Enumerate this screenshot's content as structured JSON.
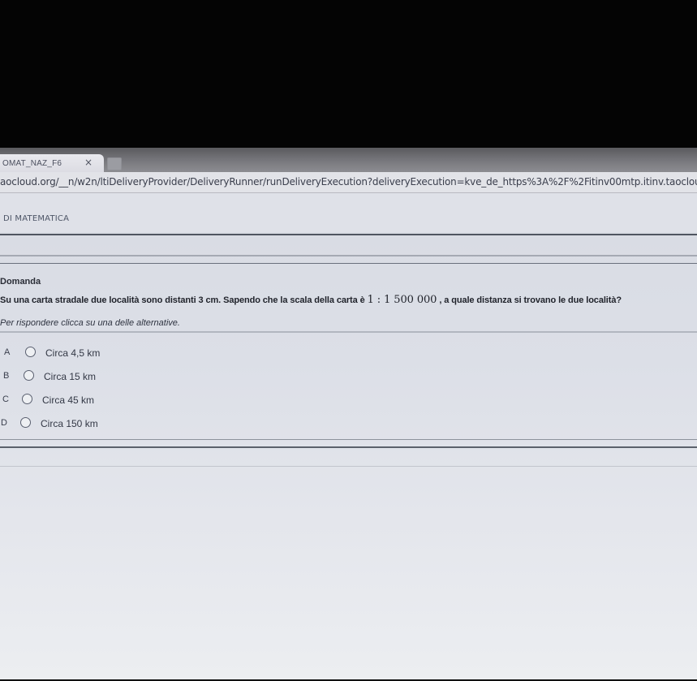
{
  "browser": {
    "tab_title": "OMAT_NAZ_F6",
    "tab_close": "×",
    "url": "aocloud.org/__n/w2n/ltiDeliveryProvider/DeliveryRunner/runDeliveryExecution?deliveryExecution=kve_de_https%3A%2F%2Fitinv00mtp.itinv.taocloud.org%2"
  },
  "page": {
    "section_title": "DI MATEMATICA",
    "question_label": "Domanda",
    "question_before": "Su una carta stradale due località sono distanti 3 cm. Sapendo che la scala della carta è",
    "question_ratio": "1 : 1 500 000",
    "question_after": ", a quale distanza si trovano le due località?",
    "instruction": "Per rispondere clicca su una delle alternative."
  },
  "options": [
    {
      "letter": "A",
      "text": "Circa 4,5 km"
    },
    {
      "letter": "B",
      "text": "Circa 15 km"
    },
    {
      "letter": "C",
      "text": "Circa 45 km"
    },
    {
      "letter": "D",
      "text": "Circa 150 km"
    }
  ],
  "colors": {
    "background": "#dcdfe7",
    "text": "#1f222a",
    "rule": "#4f5560"
  }
}
